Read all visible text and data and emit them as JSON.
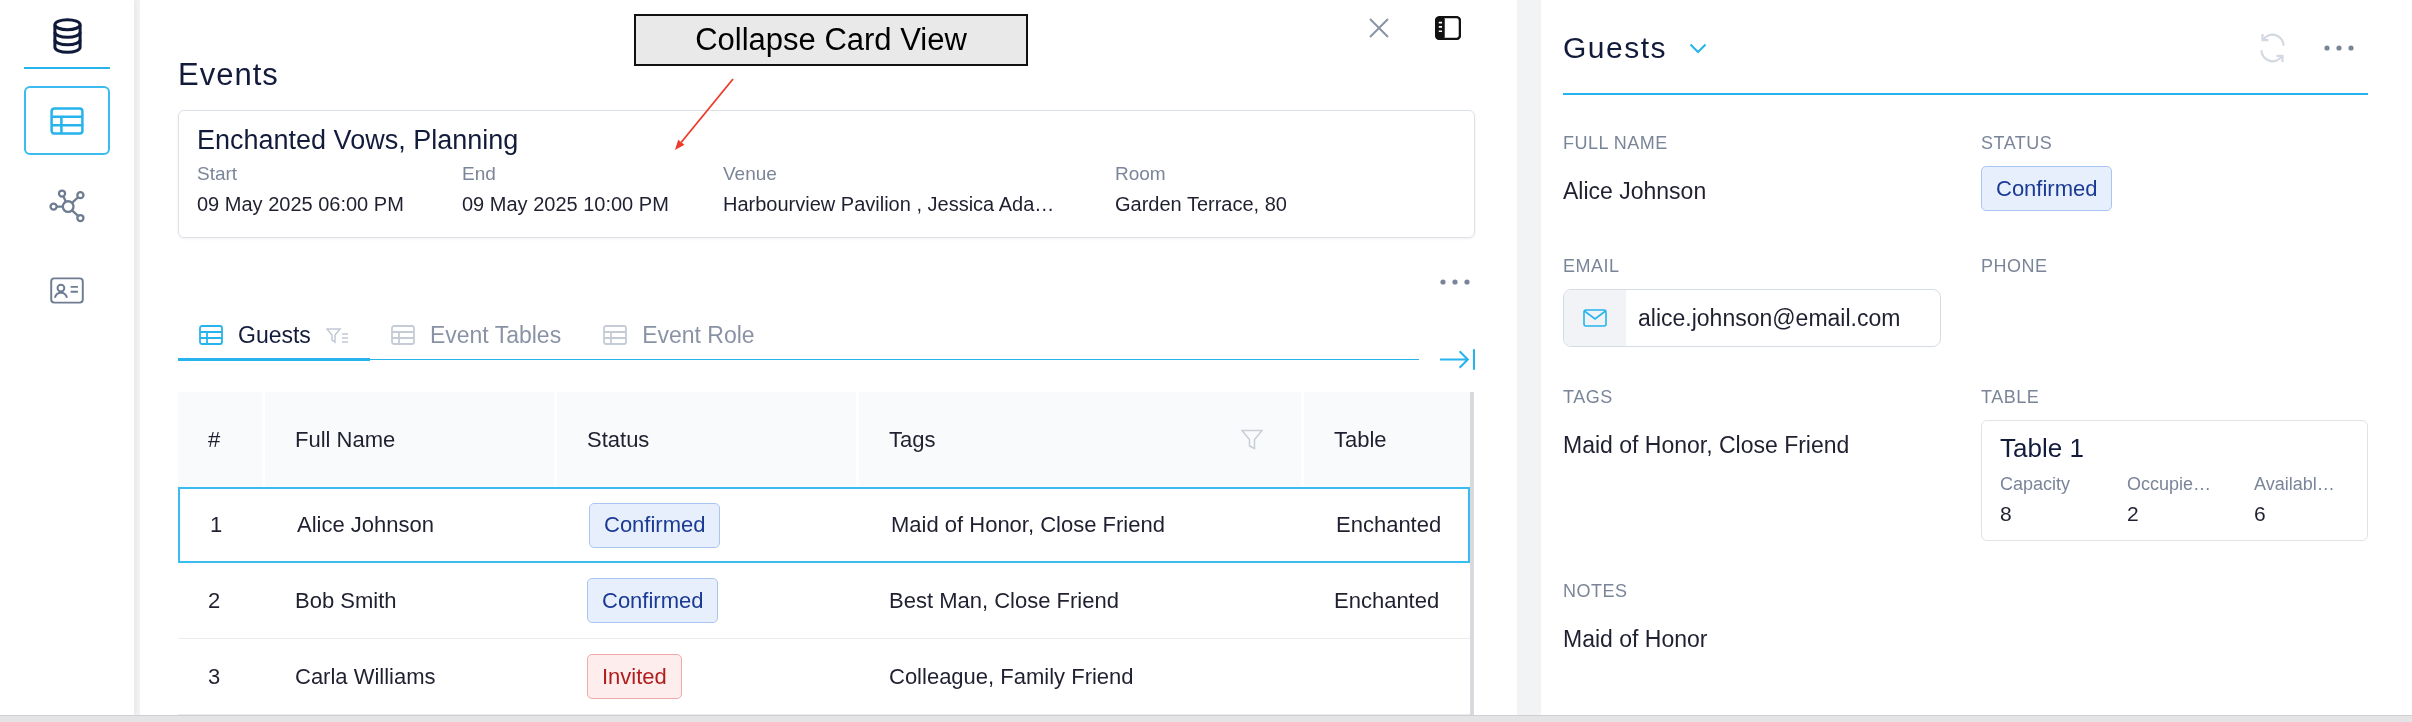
{
  "sidebar": {
    "items": [
      {
        "kind": "table",
        "selected": true
      },
      {
        "kind": "graph",
        "selected": false
      },
      {
        "kind": "contact",
        "selected": false
      }
    ]
  },
  "main": {
    "title": "Events",
    "card": {
      "title": "Enchanted Vows, Planning",
      "fields": [
        {
          "label": "Start",
          "value": "09 May 2025 06:00 PM"
        },
        {
          "label": "End",
          "value": "09 May 2025 10:00 PM"
        },
        {
          "label": "Venue",
          "value": "Harbourview Pavilion , Jessica Ada…"
        },
        {
          "label": "Room",
          "value": "Garden Terrace, 80"
        }
      ]
    },
    "tabs": [
      {
        "label": "Guests",
        "selected": true
      },
      {
        "label": "Event Tables",
        "selected": false
      },
      {
        "label": "Event Role",
        "selected": false
      }
    ],
    "table": {
      "columns": [
        {
          "label": "#",
          "filter": false
        },
        {
          "label": "Full Name",
          "filter": false
        },
        {
          "label": "Status",
          "filter": false
        },
        {
          "label": "Tags",
          "filter": true
        },
        {
          "label": "Table",
          "filter": false
        }
      ],
      "rows": [
        {
          "number": "1",
          "full_name": "Alice Johnson",
          "status": {
            "label": "Confirmed",
            "kind": "confirmed"
          },
          "tags": "Maid of Honor, Close Friend",
          "table": "Enchanted",
          "selected": true
        },
        {
          "number": "2",
          "full_name": "Bob Smith",
          "status": {
            "label": "Confirmed",
            "kind": "confirmed"
          },
          "tags": "Best Man, Close Friend",
          "table": "Enchanted",
          "selected": false
        },
        {
          "number": "3",
          "full_name": "Carla Williams",
          "status": {
            "label": "Invited",
            "kind": "invited"
          },
          "tags": "Colleague, Family Friend",
          "selected": false
        }
      ]
    }
  },
  "annotation": {
    "text": "Collapse Card View"
  },
  "detail": {
    "title": "Guests",
    "refresh": {
      "disabled": true
    },
    "fields": [
      {
        "label": "FULL NAME",
        "kind": "text",
        "value": "Alice Johnson"
      },
      {
        "label": "STATUS",
        "kind": "badge",
        "badge": {
          "label": "Confirmed",
          "kind": "confirmed"
        }
      },
      {
        "label": "EMAIL",
        "kind": "email",
        "value": "alice.johnson@email.com"
      },
      {
        "label": "PHONE",
        "kind": "text"
      },
      {
        "label": "TAGS",
        "kind": "text",
        "value": "Maid of Honor, Close Friend"
      },
      {
        "label": "TABLE",
        "kind": "table_card",
        "card": {
          "title": "Table 1",
          "stats": [
            {
              "label": "Capacity",
              "value": "8"
            },
            {
              "label": "Occupie…",
              "value": "2"
            },
            {
              "label": "Availabl…",
              "value": "6"
            }
          ]
        }
      },
      {
        "label": "NOTES",
        "kind": "text",
        "value": "Maid of Honor"
      }
    ]
  }
}
